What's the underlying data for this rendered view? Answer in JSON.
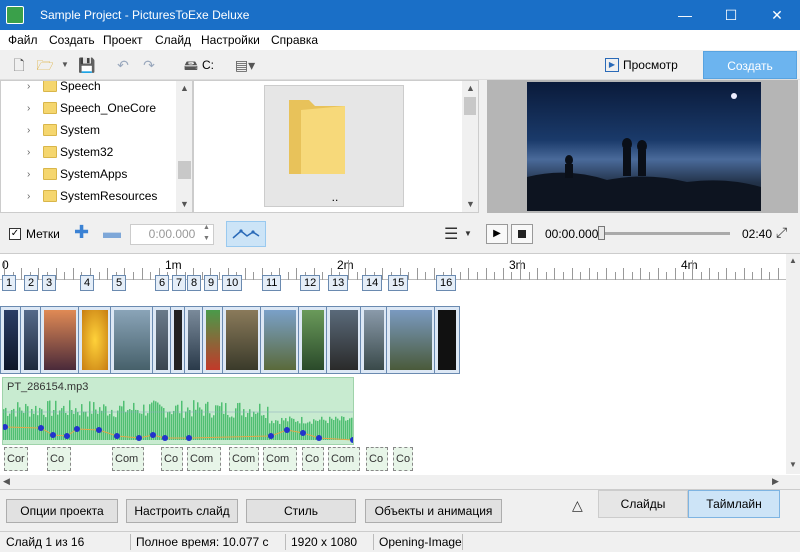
{
  "window": {
    "title": "Sample Project - PicturesToExe Deluxe",
    "minimize": "—",
    "maximize": "☐",
    "close": "✕"
  },
  "menu": [
    "Файл",
    "Создать",
    "Проект",
    "Слайд",
    "Настройки",
    "Справка"
  ],
  "toolbar": {
    "drive_label": "C:",
    "preview_label": "Просмотр",
    "create_label": "Создать"
  },
  "tree": {
    "items": [
      "Speech",
      "Speech_OneCore",
      "System",
      "System32",
      "SystemApps",
      "SystemResources"
    ]
  },
  "files": {
    "tile_label": ".."
  },
  "controls": {
    "marks_label": "Метки",
    "marks_checked": "✓",
    "time_value": "0:00.000",
    "current_time": "00:00.000",
    "duration": "02:40",
    "play": "▶",
    "seek_fraction": 0.0
  },
  "timeline": {
    "ruler_labels": [
      "0",
      "1m",
      "2m",
      "3m",
      "4m"
    ],
    "slide_numbers": [
      "1",
      "2",
      "3",
      "4",
      "5",
      "6",
      "7",
      "8",
      "9",
      "10",
      "11",
      "12",
      "13",
      "14",
      "15",
      "16"
    ],
    "audio_file": "PT_286154.mp3",
    "caption_labels": [
      "Cor",
      "Co",
      "Com",
      "Co",
      "Com",
      "Com",
      "Com",
      "Co",
      "Com",
      "Co",
      "Co"
    ]
  },
  "bottom": {
    "buttons": [
      "Опции проекта",
      "Настроить слайд",
      "Стиль",
      "Объекты и анимация"
    ],
    "tab_slides": "Слайды",
    "tab_timeline": "Таймлайн",
    "collapse": "△"
  },
  "status": {
    "slide": "Слайд 1 из 16",
    "total_time": "Полное время: 10.077 с",
    "resolution": "1920 x 1080",
    "style": "Opening-Image"
  },
  "colors": {
    "titlebar": "#1a6fc7",
    "accent": "#6cb4ef",
    "audio": "#c8ebd0",
    "waveform": "#4fbf72"
  }
}
